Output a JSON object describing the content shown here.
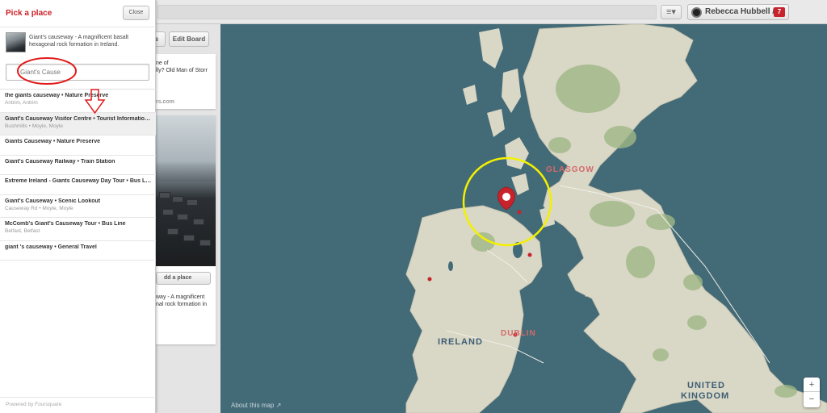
{
  "panel": {
    "title": "Pick a place",
    "close_label": "Close",
    "pin_description": "Giant's causeway - A magnificent basalt hexagonal rock formation in Ireland.",
    "search_value": "Giant's Cause",
    "results": [
      {
        "name": "the giants causeway • Nature Preserve",
        "location": "Antrim, Antrim"
      },
      {
        "name": "Giant's Causeway Visitor Centre • Tourist Information Center",
        "location": "Bushmills • Moyle, Moyle",
        "selected": true
      },
      {
        "name": "Giants Causeway • Nature Preserve",
        "location": ""
      },
      {
        "name": "Giant's Causeway Railway • Train Station",
        "location": ""
      },
      {
        "name": "Extreme Ireland - Giants Causeway Day Tour • Bus Line",
        "location": ""
      },
      {
        "name": "Giant's Causeway • Scenic Lookout",
        "location": "Causeway Rd • Moyle, Moyle"
      },
      {
        "name": "McComb's Giant's Causeway Tour • Bus Line",
        "location": "Belfast, Belfast"
      },
      {
        "name": "giant 's causeway • General Travel",
        "location": ""
      }
    ],
    "powered_by": "Powered by Foursquare"
  },
  "header": {
    "menu_icon": "≡▾",
    "user_name": "Rebecca Hubbell /...",
    "notification_count": "7"
  },
  "board": {
    "edit_label": "s",
    "edit_board_label": "Edit Board",
    "card1_line1": "ne of",
    "card1_line2": "lly? Old Man of Storr",
    "card1_source": "rs.com",
    "add_place_label": "dd a place",
    "card2_line1": "way - A magnificent",
    "card2_line2": "nal rock formation in"
  },
  "map": {
    "labels": {
      "glasgow": "GLASGOW",
      "dublin": "DUBLIN",
      "ireland": "IRELAND",
      "uk_line1": "UNITED",
      "uk_line2": "KINGDOM"
    },
    "about_label": "About this map ↗",
    "zoom_in": "+",
    "zoom_out": "−"
  },
  "colors": {
    "sea": "#436a77",
    "land": "#d9d7c6",
    "forest": "#9fb886",
    "city_text": "#d46a6a",
    "country_text": "#3d5e74",
    "brand_red": "#cb2027",
    "highlight_yellow": "#f3f000",
    "annotation_red": "#e11b1b"
  }
}
